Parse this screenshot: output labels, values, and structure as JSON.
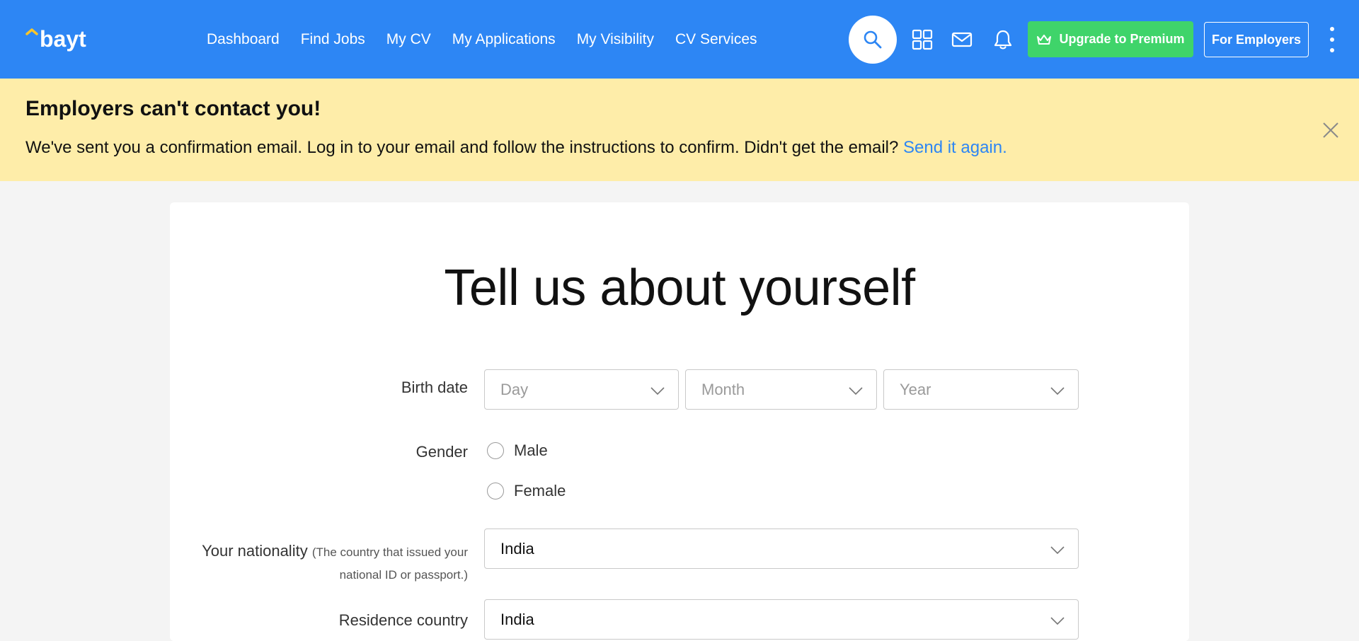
{
  "header": {
    "logo_text": "bayt",
    "nav": [
      "Dashboard",
      "Find Jobs",
      "My CV",
      "My Applications",
      "My Visibility",
      "CV Services"
    ],
    "premium_label": "Upgrade to Premium",
    "employers_label": "For Employers",
    "icons": [
      "search-icon",
      "apps-grid-icon",
      "mail-icon",
      "bell-icon",
      "crown-icon",
      "more-vertical-icon"
    ]
  },
  "banner": {
    "title": "Employers can't contact you!",
    "text": "We've sent you a confirmation email. Log in to your email and follow the instructions to confirm. Didn't get the email?",
    "link": "Send it again."
  },
  "form": {
    "title": "Tell us about yourself",
    "birth_date": {
      "label": "Birth date",
      "day_placeholder": "Day",
      "month_placeholder": "Month",
      "year_placeholder": "Year"
    },
    "gender": {
      "label": "Gender",
      "options": [
        "Male",
        "Female"
      ]
    },
    "nationality": {
      "label": "Your nationality",
      "hint": "(The country that issued your national ID or passport.)",
      "value": "India"
    },
    "residence": {
      "label": "Residence country",
      "value": "India"
    }
  },
  "colors": {
    "header_bg": "#2d86f4",
    "banner_bg": "#feeda9",
    "premium_bg": "#3fd46a",
    "link": "#2d86f4"
  }
}
